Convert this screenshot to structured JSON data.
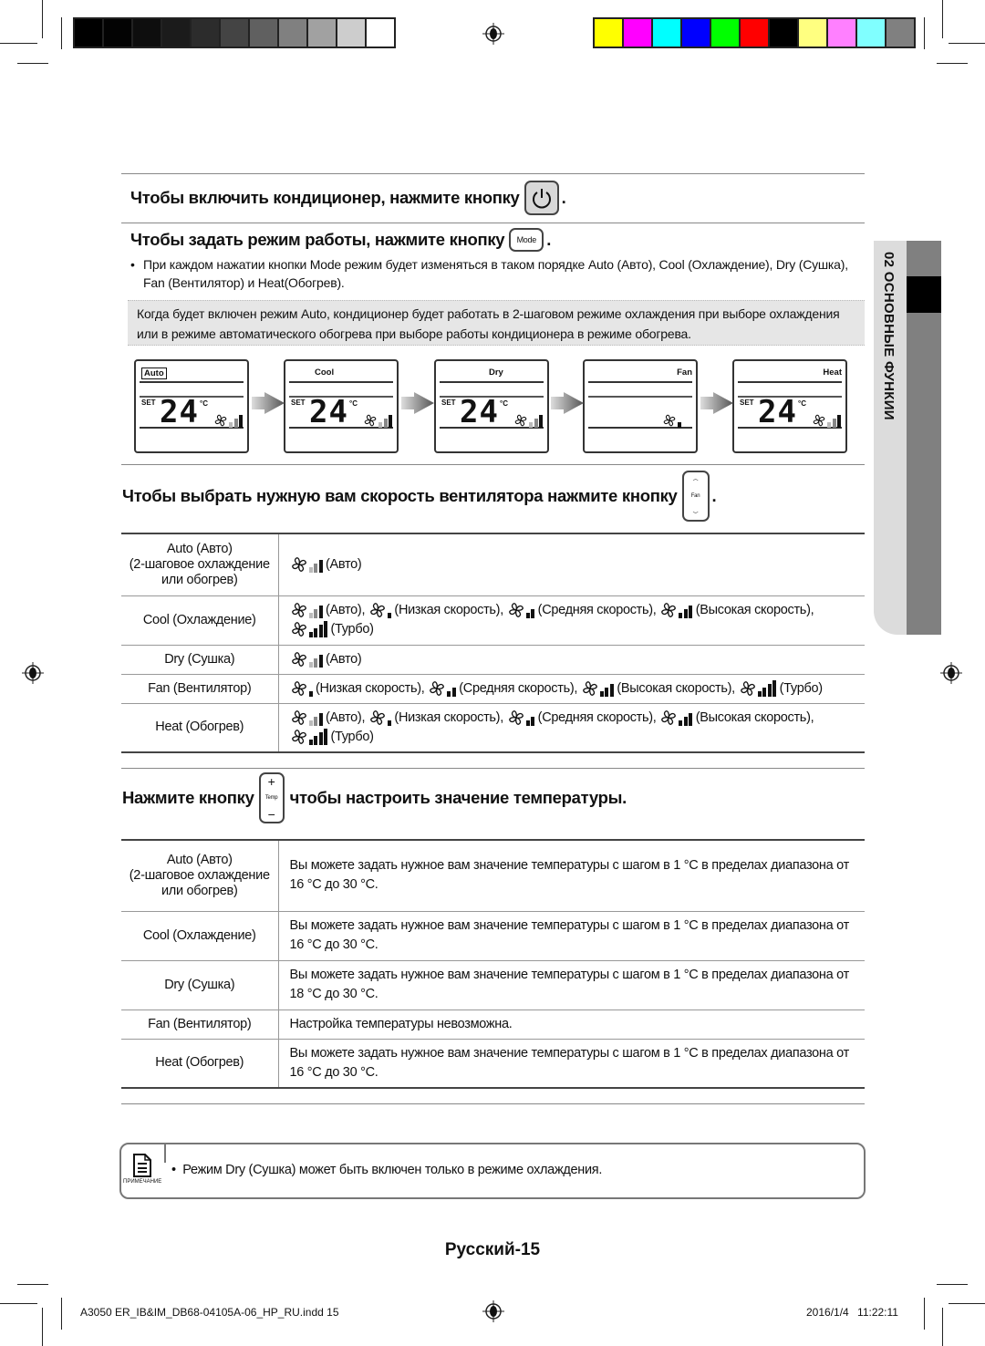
{
  "print_marks": {
    "grayscale": [
      "#000000",
      "#030303",
      "#0e0e0e",
      "#1b1b1b",
      "#2c2c2c",
      "#444444",
      "#606060",
      "#808080",
      "#a1a1a1",
      "#cdcdcd",
      "#ffffff"
    ],
    "colors": [
      "#ffff00",
      "#ff00ff",
      "#00ffff",
      "#0000ff",
      "#00ff00",
      "#ff0000",
      "#000000",
      "#ffff80",
      "#ff80ff",
      "#80ffff",
      "#808080"
    ]
  },
  "side_tab": {
    "label": "02  ОСНОВНЫЕ ФУНКИИ"
  },
  "power_section": {
    "heading": "Чтобы включить кондиционер, нажмите кнопку",
    "button_icon": "power-icon",
    "end": "."
  },
  "mode_section": {
    "heading": "Чтобы задать режим работы, нажмите кнопку",
    "button_label": "Mode",
    "end": ".",
    "bullet": "При каждом нажатии кнопки Mode режим будет изменяться в таком порядке Auto (Авто), Cool (Охлаждение), Dry (Сушка), Fan (Вентилятор) и Heat(Обогрев).",
    "note": "Когда будет включен режим Auto, кондиционер будет работать в 2-шаговом режиме охлаждения при выборе охлаждения или в режиме  автоматического обогрева при выборе работы кондиционера в режиме обогрева."
  },
  "displays": [
    {
      "mode": "Auto",
      "set": "SET",
      "temp": "24",
      "unit": "°C",
      "fan": "auto"
    },
    {
      "mode": "Cool",
      "set": "SET",
      "temp": "24",
      "unit": "°C",
      "fan": "auto"
    },
    {
      "mode": "Dry",
      "set": "SET",
      "temp": "24",
      "unit": "°C",
      "fan": "auto"
    },
    {
      "mode": "Fan",
      "set": "",
      "temp": "",
      "unit": "",
      "fan": "low"
    },
    {
      "mode": "Heat",
      "set": "SET",
      "temp": "24",
      "unit": "°C",
      "fan": "auto"
    }
  ],
  "fan_section": {
    "heading": "Чтобы выбрать нужную вам скорость вентилятора нажмите кнопку",
    "button_label": "Fan",
    "end": ".",
    "rows": [
      {
        "mode": "Auto (Авто)\n(2-шаговое охлаждение\nили обогрев)",
        "speeds": [
          {
            "level": "auto",
            "label": "(Авто)"
          }
        ]
      },
      {
        "mode": "Cool (Охлаждение)",
        "speeds": [
          {
            "level": "auto",
            "label": "(Авто), "
          },
          {
            "level": "low",
            "label": "(Низкая скорость), "
          },
          {
            "level": "mid",
            "label": "(Средняя скорость), "
          },
          {
            "level": "high",
            "label": "(Высокая скорость), "
          },
          {
            "level": "turbo",
            "label": "(Турбо)"
          }
        ]
      },
      {
        "mode": "Dry (Сушка)",
        "speeds": [
          {
            "level": "auto",
            "label": "(Авто)"
          }
        ]
      },
      {
        "mode": "Fan (Вентилятор)",
        "speeds": [
          {
            "level": "low",
            "label": "(Низкая скорость), "
          },
          {
            "level": "mid",
            "label": "(Средняя скорость), "
          },
          {
            "level": "high",
            "label": "(Высокая скорость), "
          },
          {
            "level": "turbo",
            "label": "(Турбо)"
          }
        ]
      },
      {
        "mode": "Heat (Обогрев)",
        "speeds": [
          {
            "level": "auto",
            "label": "(Авто), "
          },
          {
            "level": "low",
            "label": "(Низкая скорость), "
          },
          {
            "level": "mid",
            "label": "(Средняя скорость), "
          },
          {
            "level": "high",
            "label": "(Высокая скорость), "
          },
          {
            "level": "turbo",
            "label": "(Турбо)"
          }
        ]
      }
    ]
  },
  "temp_section": {
    "heading_pre": "Нажмите кнопку",
    "button_label": "Temp",
    "button_plus": "+",
    "button_minus": "−",
    "heading_post": "чтобы настроить значение температуры.",
    "rows": [
      {
        "mode": "Auto (Авто)\n(2-шаговое охлаждение\nили обогрев)",
        "desc": "Вы можете задать нужное вам значение температуры с шагом в 1 °C в пределах диапазона от 16 °C до 30 °C."
      },
      {
        "mode": "Cool (Охлаждение)",
        "desc": "Вы можете задать нужное вам значение температуры с шагом в 1 °C в пределах диапазона от 16 °C до 30 °C."
      },
      {
        "mode": "Dry (Сушка)",
        "desc": "Вы можете задать нужное вам значение температуры с шагом в 1 °C в пределах диапазона от 18 °C до 30 °C."
      },
      {
        "mode": "Fan (Вентилятор)",
        "desc": "Настройка температуры невозможна."
      },
      {
        "mode": "Heat (Обогрев)",
        "desc": "Вы можете задать нужное вам значение температуры с шагом в 1 °C в пределах диапазона от 16 °C до 30 °C."
      }
    ]
  },
  "note": {
    "label": "ПРИМЕЧАНИЕ",
    "text": "Режим Dry (Сушка) может быть включен только в режиме охлаждения."
  },
  "page_number": "Русский-15",
  "footer": {
    "file": "A3050 ER_IB&IM_DB68-04105A-06_HP_RU.indd   15",
    "datetime": "2016/1/4   11:22:11"
  }
}
